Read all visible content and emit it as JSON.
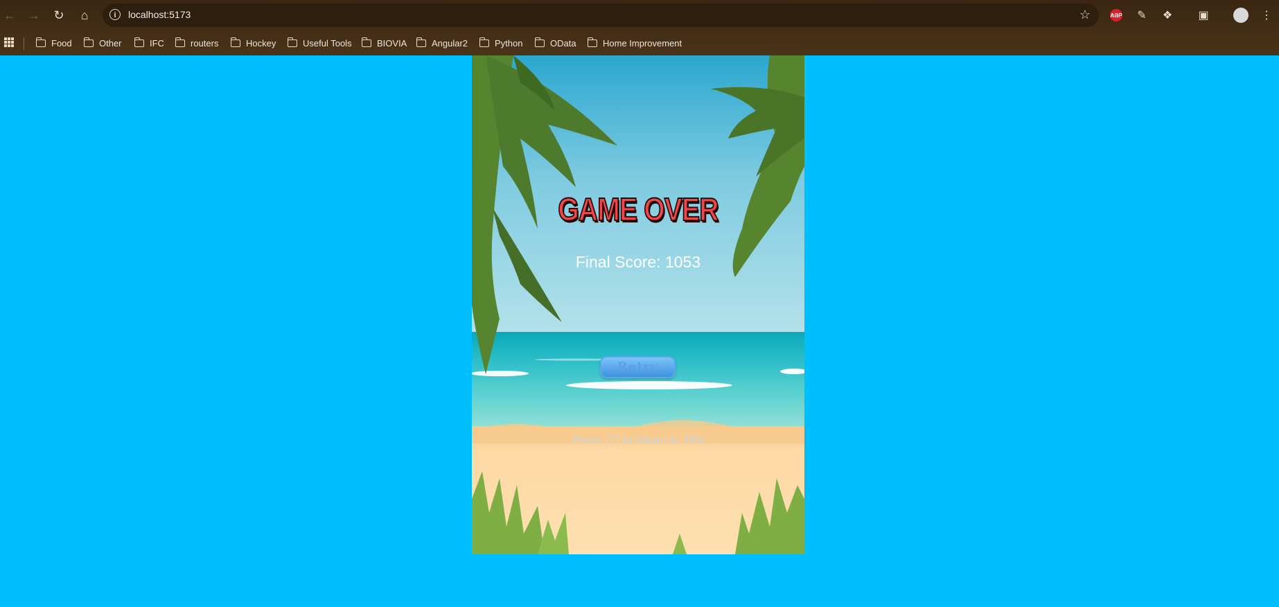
{
  "browser": {
    "url": "localhost:5173",
    "bookmarks": [
      "Food",
      "Other",
      "IFC",
      "routers",
      "Hockey",
      "Useful Tools",
      "BIOVIA",
      "Angular2",
      "Python",
      "OData",
      "Home Improvement"
    ]
  },
  "game": {
    "title": "GAME OVER",
    "score_text": "Final Score: 1053",
    "retry_label": "Retry",
    "hint": "Press [T] to return to Title"
  },
  "colors": {
    "page_background": "#00bfff",
    "title_color": "#f04848"
  }
}
